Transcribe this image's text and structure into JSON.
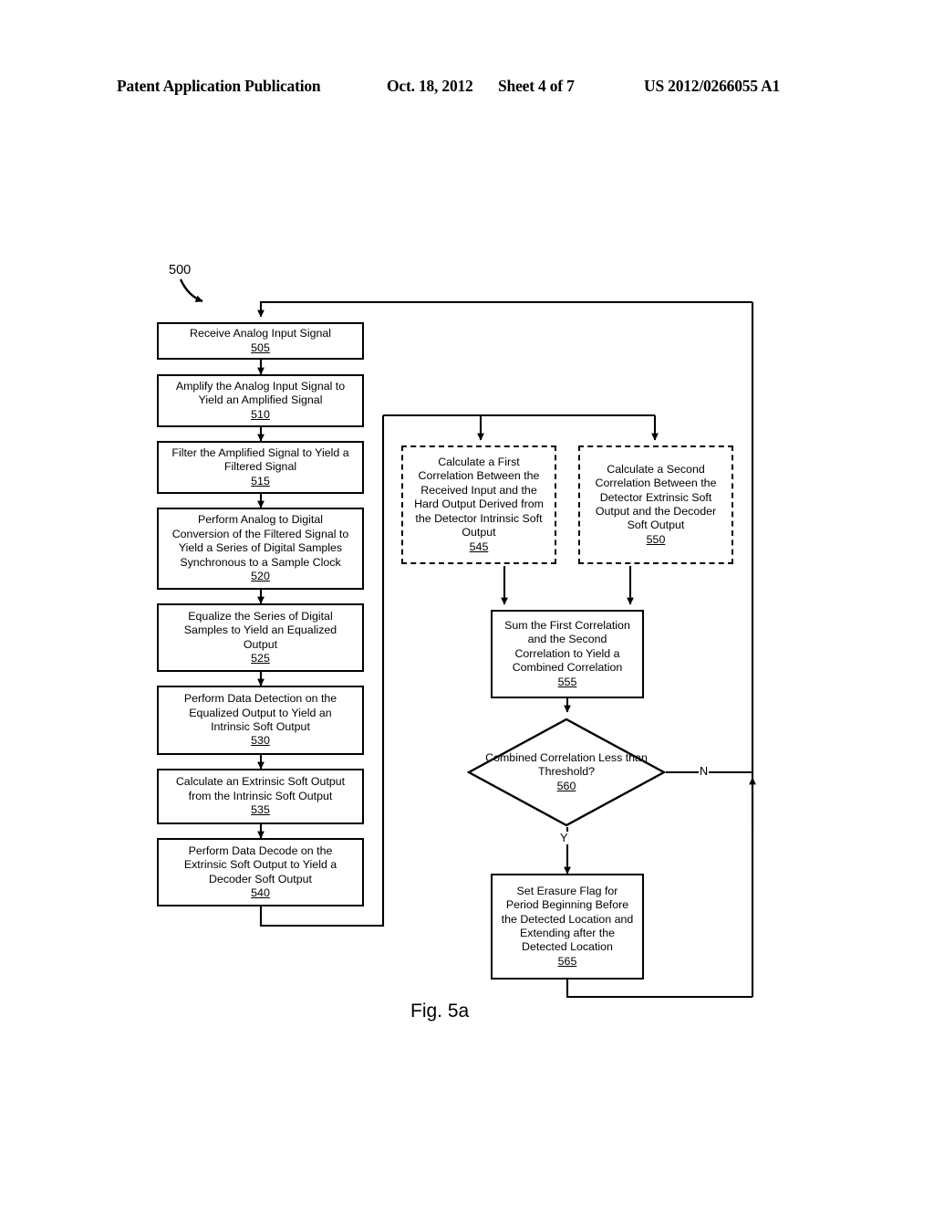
{
  "header": {
    "title": "Patent Application Publication",
    "date": "Oct. 18, 2012",
    "sheet": "Sheet 4 of 7",
    "pub_number": "US 2012/0266055 A1"
  },
  "figure": {
    "caption": "Fig. 5a",
    "flow_label": "500"
  },
  "nodes": {
    "n505": {
      "text": "Receive Analog Input Signal",
      "ref": "505"
    },
    "n510": {
      "text": "Amplify the Analog Input Signal to\nYield an Amplified Signal",
      "ref": "510"
    },
    "n515": {
      "text": "Filter the Amplified Signal to Yield a\nFiltered Signal",
      "ref": "515"
    },
    "n520": {
      "text": "Perform Analog to Digital\nConversion of the Filtered Signal to\nYield a Series of Digital Samples\nSynchronous to a Sample Clock",
      "ref": "520"
    },
    "n525": {
      "text": "Equalize the Series of Digital\nSamples to Yield an Equalized\nOutput",
      "ref": "525"
    },
    "n530": {
      "text": "Perform Data Detection on the\nEqualized Output to Yield an\nIntrinsic Soft Output",
      "ref": "530"
    },
    "n535": {
      "text": "Calculate an Extrinsic Soft Output\nfrom the Intrinsic Soft Output",
      "ref": "535"
    },
    "n540": {
      "text": "Perform Data Decode on the\nExtrinsic Soft Output to Yield a\nDecoder Soft Output",
      "ref": "540"
    },
    "n545": {
      "text": "Calculate a First\nCorrelation Between the\nReceived Input and the\nHard Output Derived from\nthe Detector Intrinsic Soft\nOutput",
      "ref": "545"
    },
    "n550": {
      "text": "Calculate a Second\nCorrelation Between the\nDetector Extrinsic Soft\nOutput and the Decoder\nSoft Output",
      "ref": "550"
    },
    "n555": {
      "text": "Sum the First Correlation\nand the Second\nCorrelation to Yield a\nCombined Correlation",
      "ref": "555"
    },
    "n560": {
      "text": "Combined\nCorrelation Less than\nThreshold?",
      "ref": "560"
    },
    "n565": {
      "text": "Set Erasure Flag for\nPeriod Beginning Before\nthe Detected Location and\nExtending after the\nDetected Location",
      "ref": "565"
    }
  },
  "edges": {
    "no_label": "N",
    "yes_label": "Y"
  },
  "colors": {
    "ink": "#000000",
    "paper": "#ffffff"
  }
}
